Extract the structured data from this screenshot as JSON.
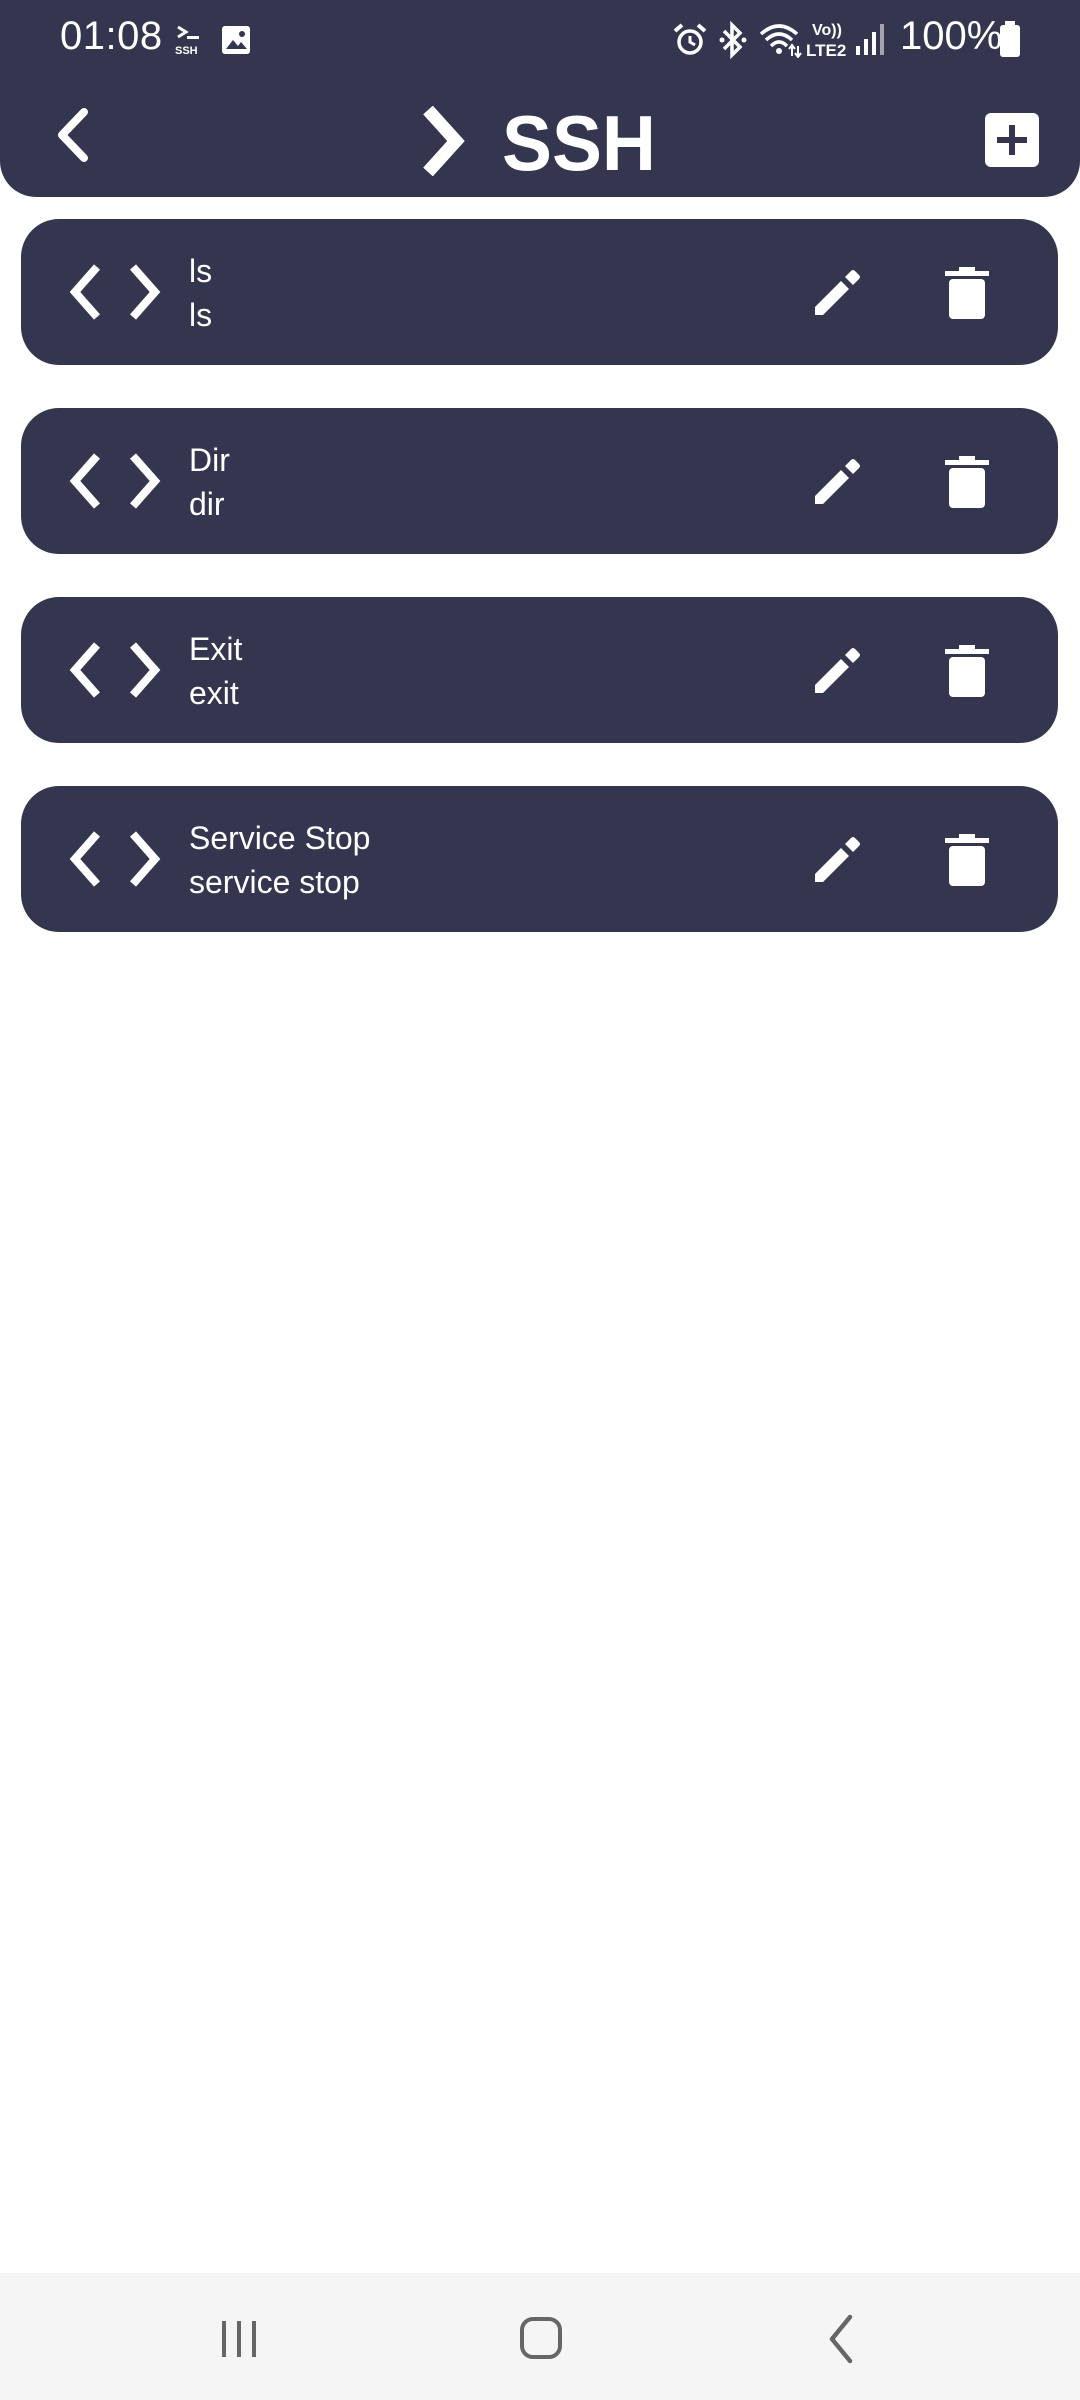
{
  "status_bar": {
    "time": "01:08",
    "battery_text": "100%",
    "notification_icons": [
      "ssh-app-icon",
      "image-icon"
    ],
    "system_icons": [
      "alarm-icon",
      "bluetooth-icon",
      "wifi-icon",
      "volte-lte2-icon",
      "signal-icon",
      "battery-icon"
    ],
    "volte_label": "Vo))",
    "lte_label": "LTE2",
    "ssh_small_label": "SSH"
  },
  "header": {
    "logo_text": "SSH",
    "background_color": "#33364e"
  },
  "commands": [
    {
      "name": "ls",
      "command": "ls"
    },
    {
      "name": "Dir",
      "command": "dir"
    },
    {
      "name": "Exit",
      "command": "exit"
    },
    {
      "name": "Service Stop",
      "command": "service stop"
    }
  ],
  "nav_bar": {
    "buttons": [
      "recent-apps",
      "home",
      "back"
    ]
  }
}
